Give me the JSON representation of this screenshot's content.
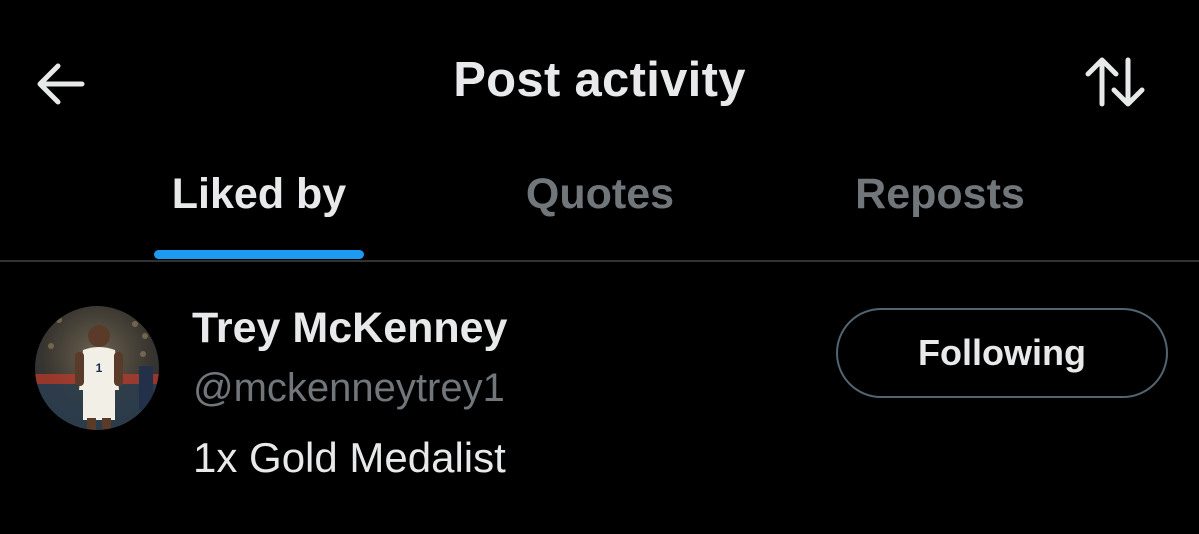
{
  "header": {
    "title": "Post activity",
    "back_icon": "arrow-left-icon",
    "sort_icon": "sort-arrows-icon"
  },
  "tabs": [
    {
      "label": "Liked by",
      "active": true
    },
    {
      "label": "Quotes",
      "active": false
    },
    {
      "label": "Reposts",
      "active": false
    }
  ],
  "users": [
    {
      "name": "Trey McKenney",
      "handle": "@mckenneytrey1",
      "bio": "1x Gold Medalist",
      "follow_label": "Following",
      "avatar_icon": "basketball-player-photo"
    }
  ],
  "colors": {
    "background": "#000000",
    "text_primary": "#e7e9ea",
    "text_secondary": "#71767b",
    "accent": "#1d9bf0",
    "divider": "#2f3336",
    "button_border": "#536471"
  }
}
